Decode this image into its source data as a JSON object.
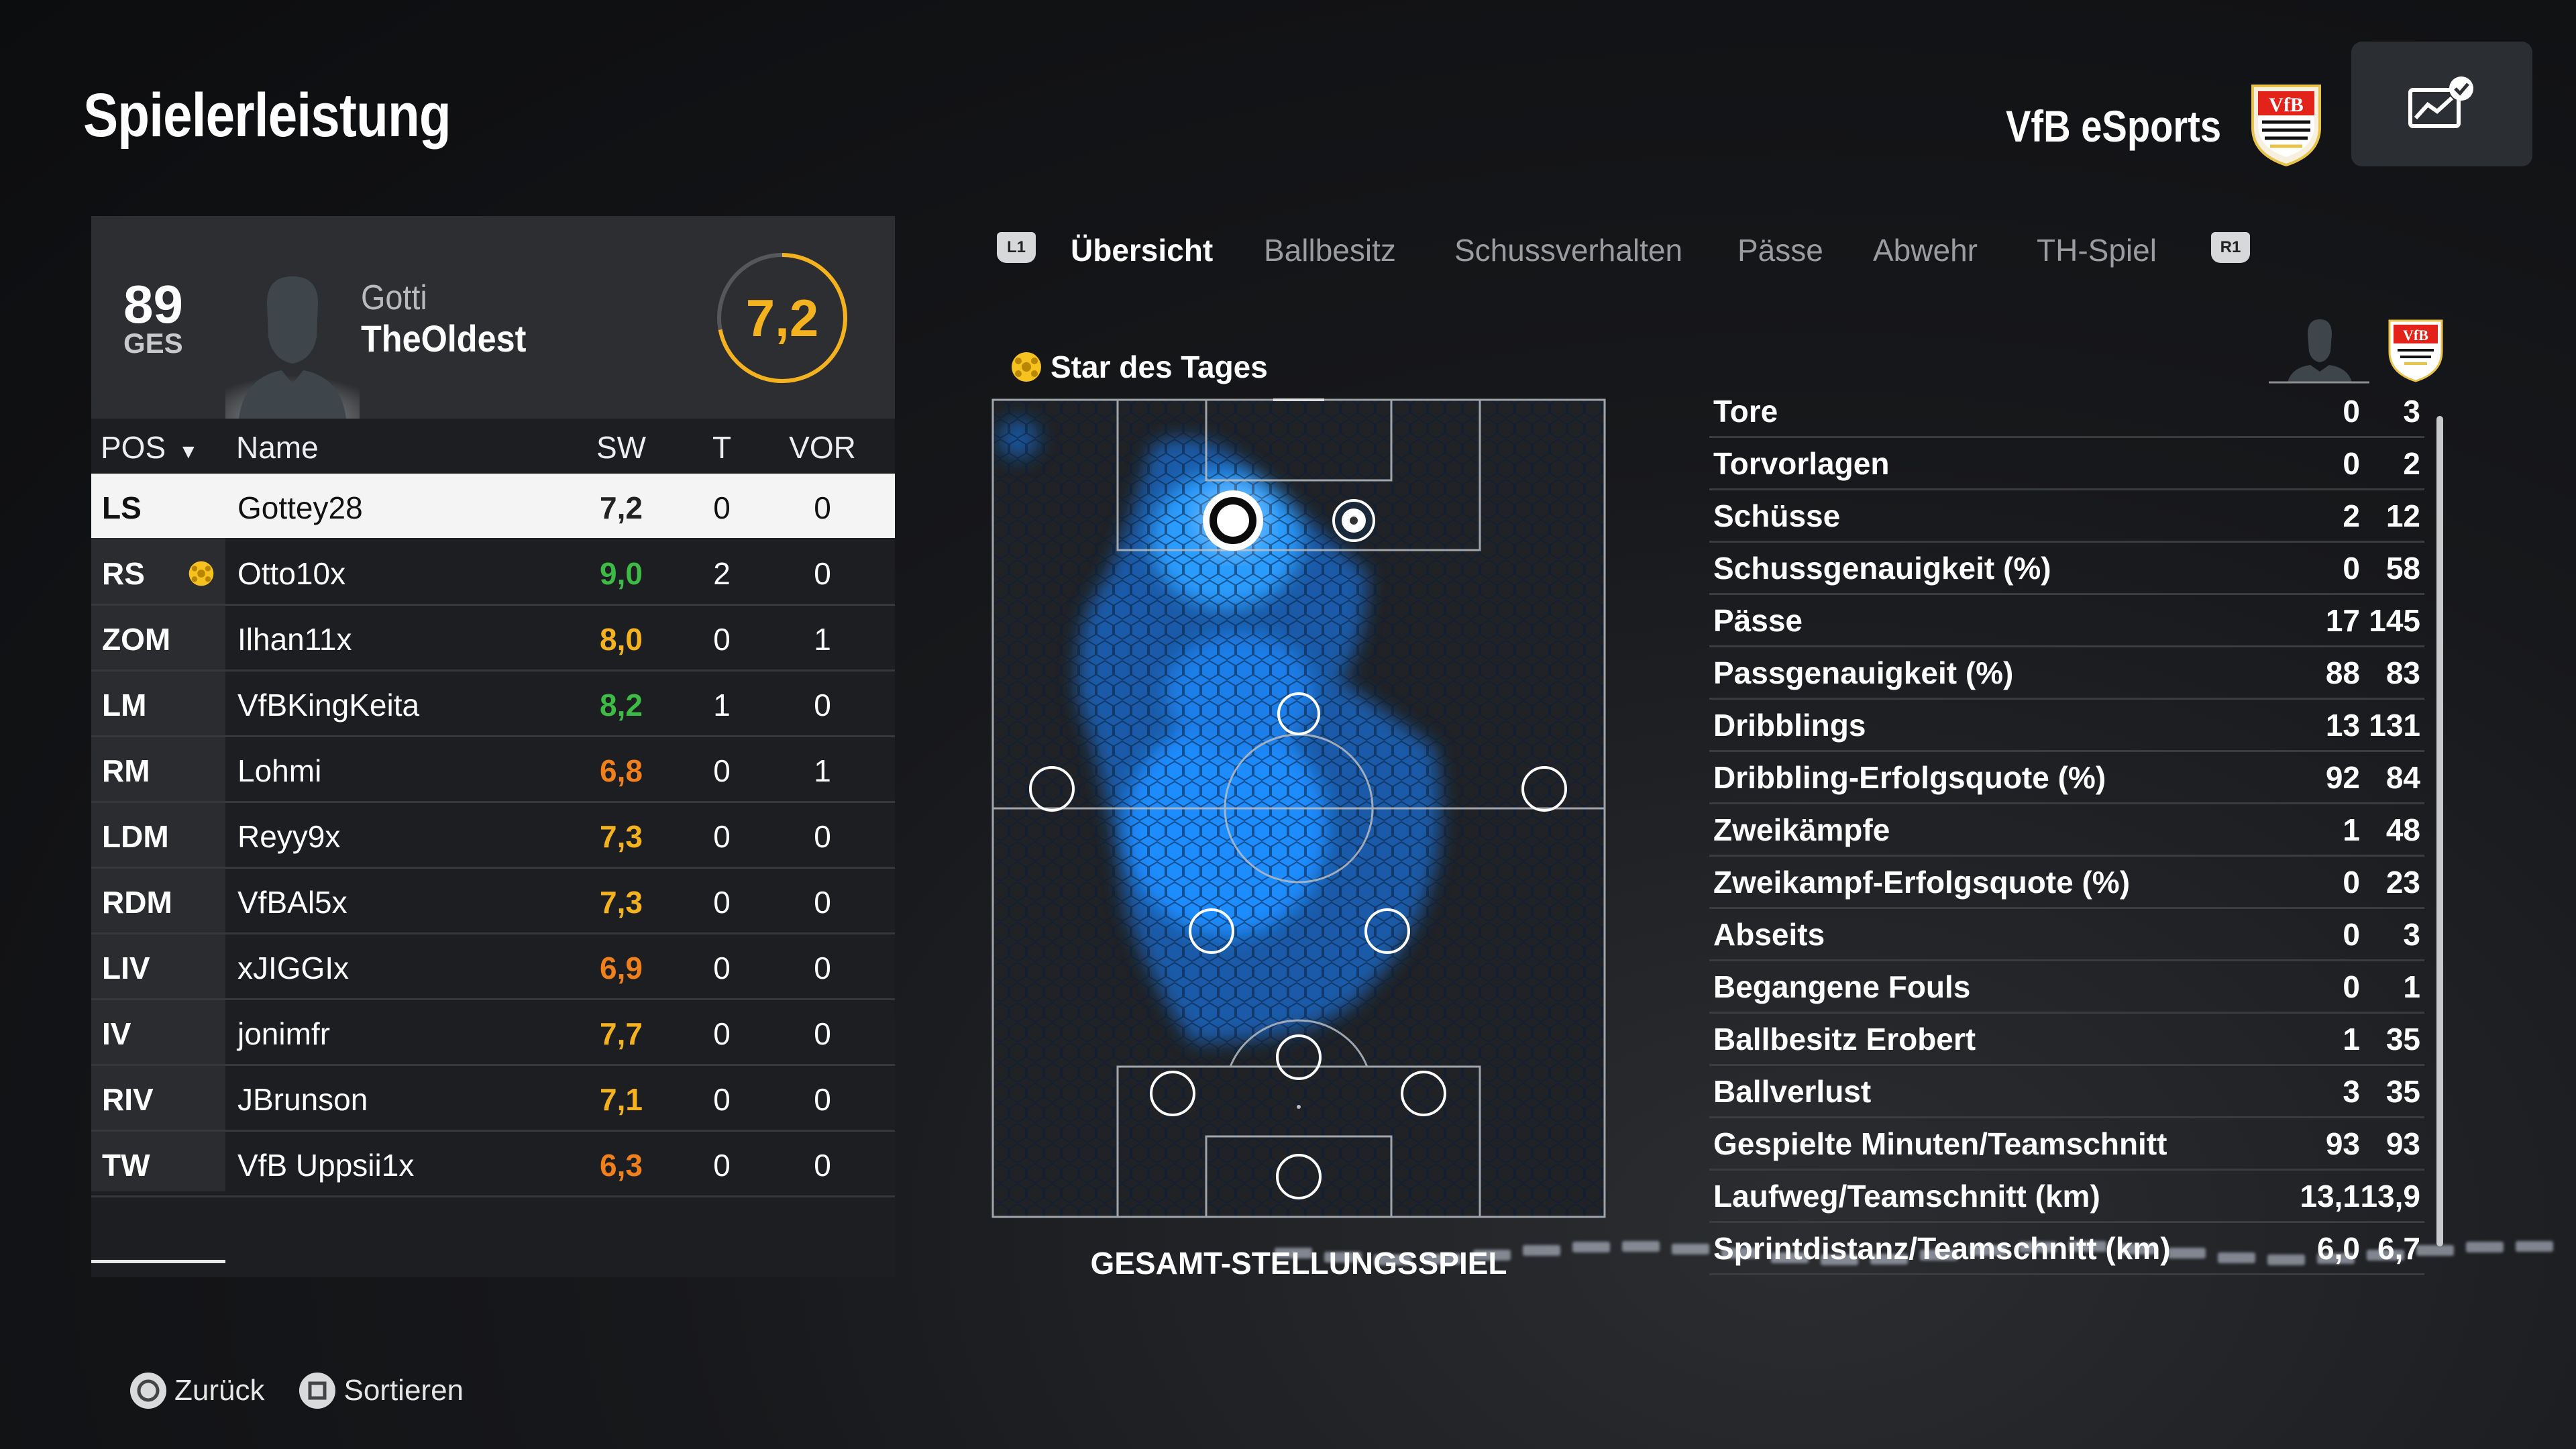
{
  "page_title": "Spielerleistung",
  "team_name": "VfB eSports",
  "player_card": {
    "overall": "89",
    "overall_label": "GES",
    "first_name": "Gotti",
    "last_name": "TheOldest",
    "rating": "7,2"
  },
  "roster": {
    "headers": {
      "pos": "POS",
      "name": "Name",
      "sw": "SW",
      "t": "T",
      "vor": "VOR"
    },
    "rows": [
      {
        "pos": "LS",
        "name": "Gottey28",
        "sw": "7,2",
        "t": "0",
        "vor": "0",
        "rating_color": "#222222",
        "selected": true
      },
      {
        "pos": "RS",
        "name": "Otto10x",
        "sw": "9,0",
        "t": "2",
        "vor": "0",
        "rating_color": "#3dbb45",
        "star": true
      },
      {
        "pos": "ZOM",
        "name": "Ilhan11x",
        "sw": "8,0",
        "t": "0",
        "vor": "1",
        "rating_color": "#f5b21f"
      },
      {
        "pos": "LM",
        "name": "VfBKingKeita",
        "sw": "8,2",
        "t": "1",
        "vor": "0",
        "rating_color": "#3dbb45"
      },
      {
        "pos": "RM",
        "name": "Lohmi",
        "sw": "6,8",
        "t": "0",
        "vor": "1",
        "rating_color": "#f0801c"
      },
      {
        "pos": "LDM",
        "name": "Reyy9x",
        "sw": "7,3",
        "t": "0",
        "vor": "0",
        "rating_color": "#f5b21f"
      },
      {
        "pos": "RDM",
        "name": "VfBAl5x",
        "sw": "7,3",
        "t": "0",
        "vor": "0",
        "rating_color": "#f5b21f"
      },
      {
        "pos": "LIV",
        "name": "xJIGGIx",
        "sw": "6,9",
        "t": "0",
        "vor": "0",
        "rating_color": "#f0801c"
      },
      {
        "pos": "IV",
        "name": "jonimfr",
        "sw": "7,7",
        "t": "0",
        "vor": "0",
        "rating_color": "#f5b21f"
      },
      {
        "pos": "RIV",
        "name": "JBrunson",
        "sw": "7,1",
        "t": "0",
        "vor": "0",
        "rating_color": "#f5b21f"
      },
      {
        "pos": "TW",
        "name": "VfB Uppsii1x",
        "sw": "6,3",
        "t": "0",
        "vor": "0",
        "rating_color": "#f0801c"
      }
    ]
  },
  "tabs": {
    "left_bumper": "L1",
    "right_bumper": "R1",
    "items": [
      "Übersicht",
      "Ballbesitz",
      "Schussverhalten",
      "Pässe",
      "Abwehr",
      "TH-Spiel"
    ],
    "active": "Übersicht"
  },
  "star_of_day": "Star des Tages",
  "pitch_caption": "GESAMT-STELLUNGSSPIEL",
  "stats": [
    {
      "label": "Tore",
      "player": "0",
      "team": "3"
    },
    {
      "label": "Torvorlagen",
      "player": "0",
      "team": "2"
    },
    {
      "label": "Schüsse",
      "player": "2",
      "team": "12"
    },
    {
      "label": "Schussgenauigkeit (%)",
      "player": "0",
      "team": "58"
    },
    {
      "label": "Pässe",
      "player": "17",
      "team": "145"
    },
    {
      "label": "Passgenauigkeit (%)",
      "player": "88",
      "team": "83"
    },
    {
      "label": "Dribblings",
      "player": "13",
      "team": "131"
    },
    {
      "label": "Dribbling-Erfolgsquote (%)",
      "player": "92",
      "team": "84"
    },
    {
      "label": "Zweikämpfe",
      "player": "1",
      "team": "48"
    },
    {
      "label": "Zweikampf-Erfolgsquote (%)",
      "player": "0",
      "team": "23"
    },
    {
      "label": "Abseits",
      "player": "0",
      "team": "3"
    },
    {
      "label": "Begangene Fouls",
      "player": "0",
      "team": "1"
    },
    {
      "label": "Ballbesitz Erobert",
      "player": "1",
      "team": "35"
    },
    {
      "label": "Ballverlust",
      "player": "3",
      "team": "35"
    },
    {
      "label": "Gespielte Minuten/Teamschnitt",
      "player": "93",
      "team": "93"
    },
    {
      "label": "Laufweg/Teamschnitt (km)",
      "player": "13,1",
      "team": "13,9"
    },
    {
      "label": "Sprintdistanz/Teamschnitt (km)",
      "player": "6,0",
      "team": "6,7"
    }
  ],
  "footer": {
    "back": "Zurück",
    "sort": "Sortieren"
  },
  "colors": {
    "accent": "#f5b21f",
    "heatmap": "#1b8cff",
    "good": "#3dbb45",
    "ok": "#f5b21f",
    "low": "#f0801c"
  },
  "icons": {
    "stats_button": "chart-check-icon",
    "star": "star-ball-icon",
    "back": "circle-button-icon",
    "sort": "square-button-icon"
  }
}
